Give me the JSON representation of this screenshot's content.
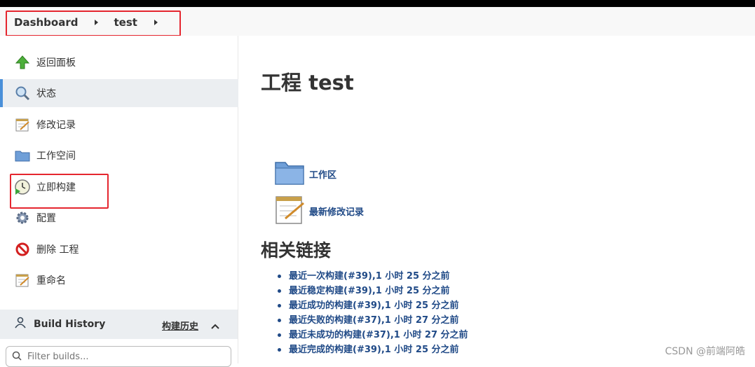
{
  "breadcrumb": {
    "items": [
      "Dashboard",
      "test"
    ]
  },
  "sidebar": {
    "tasks": [
      {
        "label": "返回面板",
        "icon": "up-arrow-icon"
      },
      {
        "label": "状态",
        "icon": "magnifier-icon"
      },
      {
        "label": "修改记录",
        "icon": "notepad-icon"
      },
      {
        "label": "工作空间",
        "icon": "folder-icon"
      },
      {
        "label": "立即构建",
        "icon": "clock-build-icon"
      },
      {
        "label": "配置",
        "icon": "gear-icon"
      },
      {
        "label": "删除 工程",
        "icon": "no-entry-icon"
      },
      {
        "label": "重命名",
        "icon": "notepad-icon"
      }
    ],
    "active_index": 1
  },
  "build_history": {
    "title": "Build History",
    "link": "构建历史",
    "filter_placeholder": "Filter builds..."
  },
  "main": {
    "title": "工程 test",
    "links": [
      {
        "label": "工作区",
        "icon": "folder-icon"
      },
      {
        "label": "最新修改记录",
        "icon": "notepad-icon"
      }
    ],
    "related_title": "相关链接",
    "related": [
      "最近一次构建(#39),1 小时 25 分之前",
      "最近稳定构建(#39),1 小时 25 分之前",
      "最近成功的构建(#39),1 小时 25 分之前",
      "最近失败的构建(#37),1 小时 27 分之前",
      "最近未成功的构建(#37),1 小时 27 分之前",
      "最近完成的构建(#39),1 小时 25 分之前"
    ]
  },
  "watermark": "CSDN @前端阿皓",
  "colors": {
    "link": "#204a87",
    "highlight_box": "#e5262f",
    "active_bar": "#4a90d9"
  }
}
